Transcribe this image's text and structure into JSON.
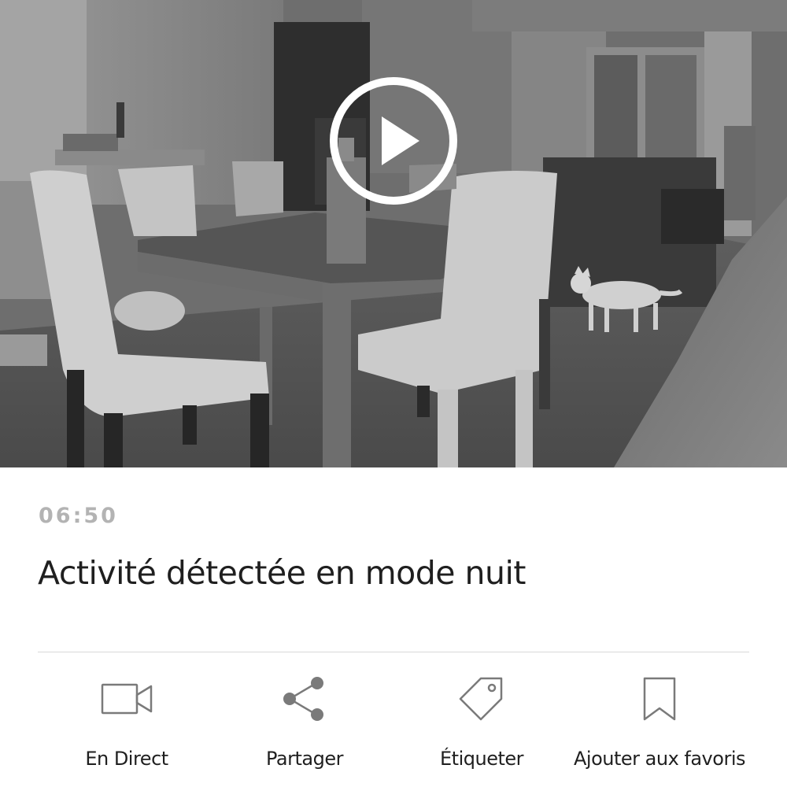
{
  "event": {
    "time": "06:50",
    "title": "Activité détectée en mode nuit"
  },
  "video": {
    "play_icon": "play-icon",
    "mode": "night"
  },
  "actions": [
    {
      "label": "En Direct",
      "icon": "video-camera-icon"
    },
    {
      "label": "Partager",
      "icon": "share-icon"
    },
    {
      "label": "Étiqueter",
      "icon": "tag-icon"
    },
    {
      "label": "Ajouter aux favoris",
      "icon": "bookmark-icon"
    }
  ],
  "colors": {
    "time_text": "#b3b3b3",
    "title_text": "#1f1f1f",
    "icon_stroke": "#7a7a7a",
    "divider": "#d9d9d9"
  }
}
